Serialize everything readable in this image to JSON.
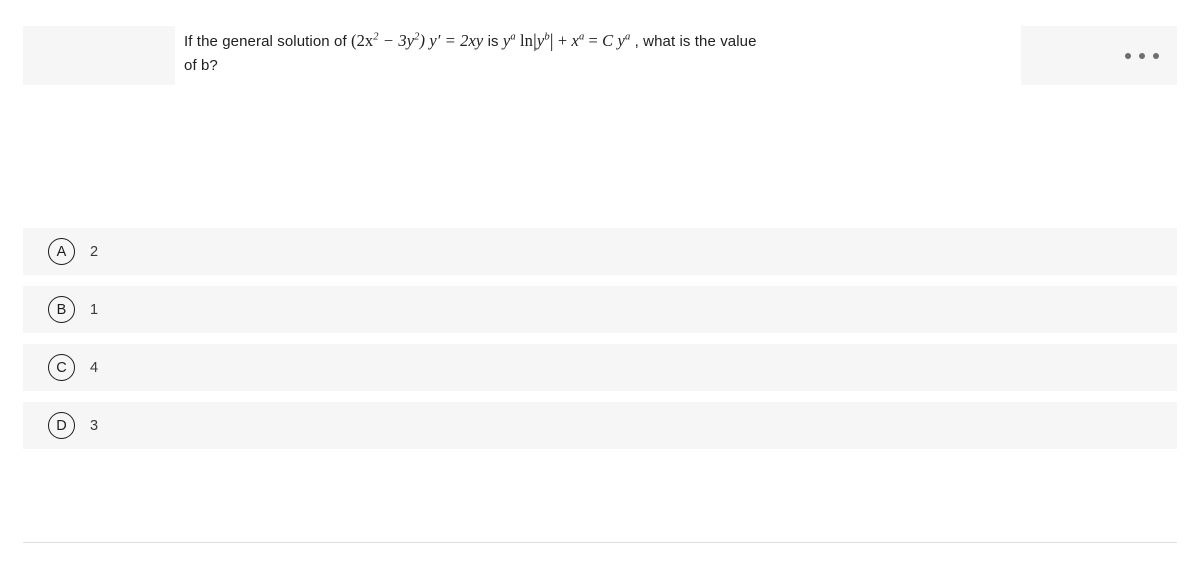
{
  "question": {
    "line1_prefix": "If the general solution of ",
    "math_lhs_open": "(2x",
    "math_lhs_exp1": "2",
    "math_lhs_minus": " − 3y",
    "math_lhs_exp2": "2",
    "math_lhs_close": ") y′ = 2xy",
    "connector": " is ",
    "math_rhs_y": "y",
    "math_rhs_a1": "a",
    "math_rhs_ln": "ln",
    "math_rhs_bar_open": "|",
    "math_rhs_y2": "y",
    "math_rhs_b": "b",
    "math_rhs_bar_close": "|",
    "math_rhs_plus": " + ",
    "math_rhs_x": "x",
    "math_rhs_a2": "a",
    "math_rhs_eq": " = ",
    "math_rhs_C": "C ",
    "math_rhs_y3": "y",
    "math_rhs_a3": "a",
    "line1_suffix": " , what is the value",
    "line2": "of b?",
    "full_text": "If the general solution of (2x² − 3y²) y′ = 2xy is yᵃ ln|yᵇ| + xᵃ = C yᵃ , what is the value of b?"
  },
  "more_menu": {
    "icon": "ellipsis-horizontal-icon",
    "label": "•••"
  },
  "options": [
    {
      "letter": "A",
      "value": "2"
    },
    {
      "letter": "B",
      "value": "1"
    },
    {
      "letter": "C",
      "value": "4"
    },
    {
      "letter": "D",
      "value": "3"
    }
  ],
  "colors": {
    "panel_background": "#f6f6f6",
    "page_background": "#ffffff",
    "text": "#202020",
    "option_value_text": "#3a3a3a",
    "circle_border": "#1d1d1d",
    "divider": "#dedede",
    "ellipsis_dot": "#6e6e6e"
  }
}
